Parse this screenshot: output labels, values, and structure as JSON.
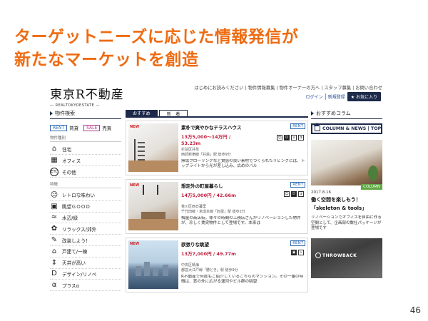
{
  "slide": {
    "title_line1": "ターゲットニーズに応じた情報発信が",
    "title_line2": "新たなマーケットを創造",
    "page_number": "46"
  },
  "site": {
    "logo": "東京R不動産",
    "logo_sub": "— REALTOKYOESTATE —",
    "top_links": "はじめにお読みください | 物件情報募集 | 物件オーナーの方へ | スタッフ募集 | お問い合わせ",
    "login_label": "ログイン",
    "register_label": "新規登録",
    "favorites_label": "★ お気に入り"
  },
  "search": {
    "header": "物件検索",
    "rent_tag": "RENT",
    "rent_label": "賃貸",
    "sale_tag": "SALE",
    "sale_label": "売買",
    "group_type": "物件種別",
    "types": [
      {
        "icon": "house-icon",
        "glyph": "⌂",
        "label": "住宅"
      },
      {
        "icon": "office-icon",
        "glyph": "▦",
        "label": "オフィス"
      },
      {
        "icon": "etc-icon",
        "glyph": "ETC",
        "label": "その他"
      }
    ],
    "group_feature": "特徴",
    "features": [
      {
        "icon": "retro-icon",
        "glyph": "☺",
        "label": "レトロな味わい"
      },
      {
        "icon": "view-icon",
        "glyph": "▣",
        "label": "眺望ＧＯＯＤ"
      },
      {
        "icon": "water-icon",
        "glyph": "≈",
        "label": "水辺/緑"
      },
      {
        "icon": "resort-icon",
        "glyph": "✿",
        "label": "リラックス/郊外"
      },
      {
        "icon": "renovate-icon",
        "glyph": "✎",
        "label": "改装しよう！"
      },
      {
        "icon": "detached-icon",
        "glyph": "⌂",
        "label": "戸建て/一棟"
      },
      {
        "icon": "high-ceiling-icon",
        "glyph": "⇕",
        "label": "天井が高い"
      },
      {
        "icon": "design-icon",
        "glyph": "D",
        "label": "デザイン/リノベ"
      },
      {
        "icon": "plus-icon",
        "glyph": "α",
        "label": "プラスα"
      }
    ]
  },
  "listings": {
    "tab_recommended": "おすすめ",
    "tab_new": "新　着",
    "items": [
      {
        "new": "NEW",
        "title": "素朴で爽やかなテラスハウス",
        "badge": "RENT",
        "price": "13万5,000〜14万円 /",
        "area": "53.23m",
        "meta1": "杉並区井草",
        "meta2": "西武新宿線「井荻」駅 徒歩9分",
        "desc": "無垢フローリングなど質感の良い素材でつくられたリビングには、トップライトから光が差し込み、広めのバル"
      },
      {
        "new": "NEW",
        "title": "想定外の町屋暮らし",
        "badge": "RENT",
        "price": "14万5,000円 / 42.66m",
        "area": "",
        "meta1": "荒川区西日暮里",
        "meta2": "千代田線・京成本線「町屋」駅 徒歩2分",
        "desc": "梅屋の商店街。様々の時間の工務店さんがリノベーションした物件が、珍しく賃貸物件として登場です。本来は"
      },
      {
        "new": "NEW",
        "title": "欲張りな眺望",
        "badge": "RENT",
        "price": "13万7,000円 / 49.77m",
        "area": "",
        "meta1": "中央区晴海",
        "meta2": "都営大江戸線「勝どき」駅 徒歩9分",
        "desc": "R不動産で何度もご紹介しているこちらのマンション。その一番の特徴は、窓の外に広がる運河やビル群の眺望"
      }
    ]
  },
  "column": {
    "header": "おすすめコラム",
    "box_label": "COLUMN & NEWS | TOP",
    "badge": "COLUMN",
    "date": "2017.8.16",
    "title1": "働く空間を楽しもう！",
    "title2": "「skeleton & tools」",
    "desc": "リノベーションでオフィスを自由に作る空間として、企画部の数社パッケージが登場です",
    "throwback": "THROWBACK"
  }
}
